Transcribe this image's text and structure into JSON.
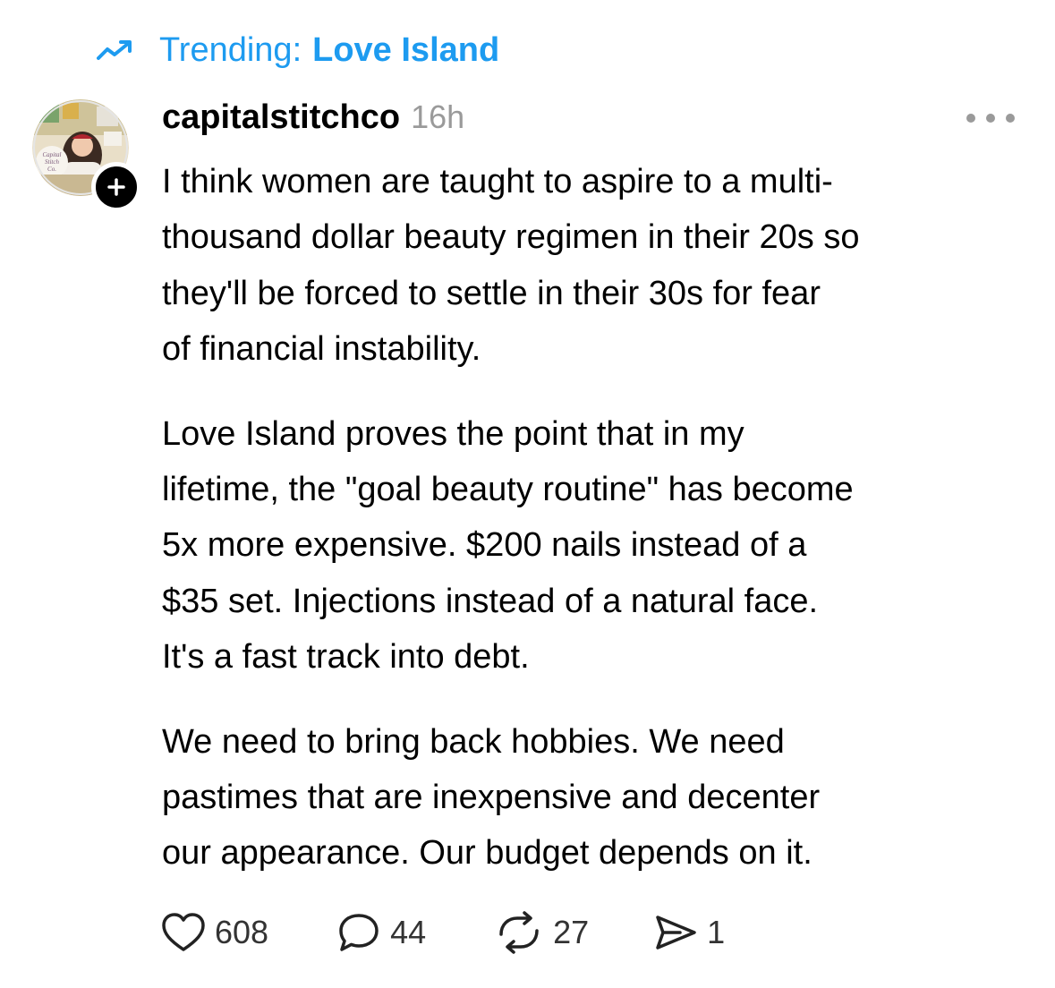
{
  "trending": {
    "prefix": "Trending:",
    "topic": "Love Island",
    "icon": "trending-up-icon",
    "color": "#1d9bf0"
  },
  "post": {
    "username": "capitalstitchco",
    "timestamp": "16h",
    "avatar_text": "Capital Stitch Co.",
    "paragraphs": [
      "I think women are taught to aspire to a multi-\nthousand dollar beauty regimen in their 20s so\nthey'll be forced to settle in their 30s for fear\nof financial instability.",
      "Love Island proves the point that in my\nlifetime, the \"goal beauty routine\" has become\n5x more expensive. $200 nails instead of a\n$35 set. Injections instead of a natural face.\nIt's a fast track into debt.",
      "We need to bring back hobbies. We need\npastimes that are inexpensive and decenter\nour appearance. Our budget depends on it."
    ],
    "actions": {
      "likes": "608",
      "replies": "44",
      "reposts": "27",
      "shares": "1"
    }
  },
  "icons": {
    "follow": "plus-icon",
    "more": "more-horizontal-icon",
    "like": "heart-icon",
    "reply": "speech-bubble-icon",
    "repost": "repost-icon",
    "share": "send-icon"
  },
  "colors": {
    "accent": "#1d9bf0",
    "muted": "#9a9a9a",
    "text": "#000000",
    "action_text": "#333333"
  }
}
